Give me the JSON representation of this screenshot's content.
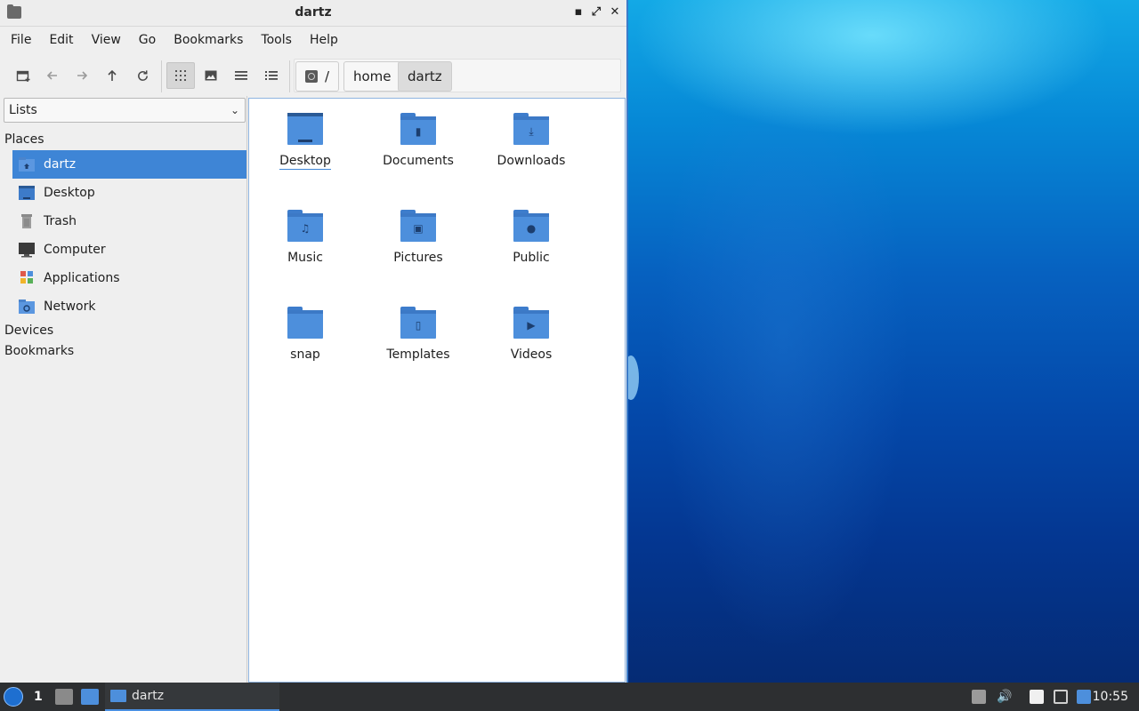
{
  "window": {
    "title": "dartz"
  },
  "menubar": {
    "items": [
      "File",
      "Edit",
      "View",
      "Go",
      "Bookmarks",
      "Tools",
      "Help"
    ]
  },
  "toolbar": {
    "buttons": [
      {
        "name": "new-tab",
        "icon": "new-tab-icon"
      },
      {
        "name": "back",
        "icon": "arrow-left-icon"
      },
      {
        "name": "forward",
        "icon": "arrow-right-icon"
      },
      {
        "name": "up",
        "icon": "arrow-up-icon"
      },
      {
        "name": "reload",
        "icon": "reload-icon"
      },
      {
        "name": "icon-view",
        "icon": "grid-icon",
        "active": true
      },
      {
        "name": "thumbnail-view",
        "icon": "image-icon"
      },
      {
        "name": "compact-view",
        "icon": "lines-icon"
      },
      {
        "name": "detailed-list-view",
        "icon": "list-icon"
      }
    ]
  },
  "pathbar": {
    "crumbs": [
      "/",
      "home",
      "dartz"
    ],
    "current": "dartz"
  },
  "sidebar": {
    "mode": "Lists",
    "places_header": "Places",
    "places": [
      {
        "label": "dartz",
        "icon": "home-folder-icon",
        "selected": true
      },
      {
        "label": "Desktop",
        "icon": "desktop-icon"
      },
      {
        "label": "Trash",
        "icon": "trash-icon"
      },
      {
        "label": "Computer",
        "icon": "computer-icon"
      },
      {
        "label": "Applications",
        "icon": "applications-icon"
      },
      {
        "label": "Network",
        "icon": "network-icon"
      }
    ],
    "devices_header": "Devices",
    "bookmarks_header": "Bookmarks"
  },
  "files": [
    {
      "label": "Desktop",
      "emblem": "desktop-icon"
    },
    {
      "label": "Documents",
      "emblem": "document-icon"
    },
    {
      "label": "Downloads",
      "emblem": "download-icon"
    },
    {
      "label": "Music",
      "emblem": "music-icon"
    },
    {
      "label": "Pictures",
      "emblem": "picture-icon"
    },
    {
      "label": "Public",
      "emblem": "share-icon"
    },
    {
      "label": "snap",
      "emblem": ""
    },
    {
      "label": "Templates",
      "emblem": "template-icon"
    },
    {
      "label": "Videos",
      "emblem": "video-icon"
    }
  ],
  "taskbar": {
    "workspace": "1",
    "task_label": "dartz",
    "clock": "10:55"
  },
  "colors": {
    "accent": "#3e85d6",
    "folder": "#4d8fdc",
    "taskbar": "#2d2f31"
  }
}
